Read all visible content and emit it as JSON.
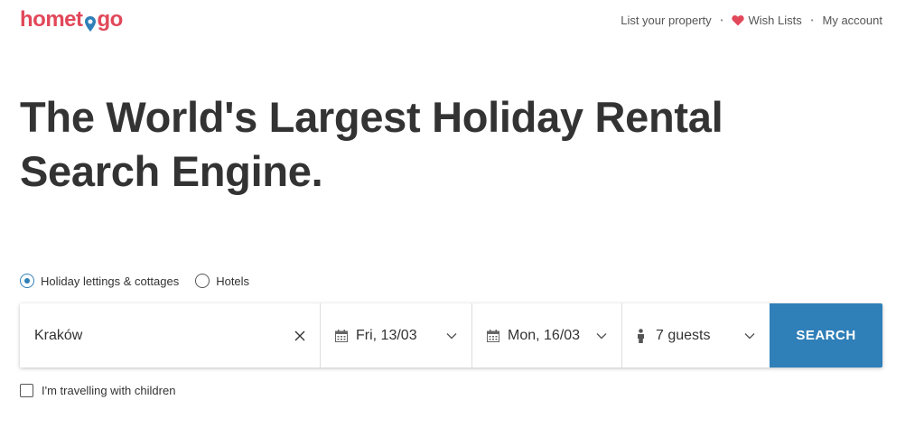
{
  "logo": {
    "before": "homet",
    "after": "go",
    "alt": "hometogo"
  },
  "nav": {
    "list_property": "List your property",
    "wish_lists": "Wish Lists",
    "my_account": "My account",
    "separator": "•"
  },
  "hero": {
    "line1": "The World's Largest Holiday Rental",
    "line2": "Search Engine."
  },
  "search_type": {
    "options": [
      {
        "label": "Holiday lettings & cottages",
        "selected": true
      },
      {
        "label": "Hotels",
        "selected": false
      }
    ]
  },
  "search": {
    "destination": "Kraków",
    "checkin": "Fri, 13/03",
    "checkout": "Mon, 16/03",
    "guests": "7 guests",
    "button": "SEARCH"
  },
  "children_checkbox": {
    "label": "I'm travelling with children",
    "checked": false
  },
  "colors": {
    "brand_red": "#e1485a",
    "brand_blue": "#2f7fb8",
    "text": "#333333"
  },
  "icons": [
    "location-pin-icon",
    "heart-icon",
    "clear-icon",
    "calendar-icon",
    "chevron-down-icon",
    "person-icon"
  ]
}
